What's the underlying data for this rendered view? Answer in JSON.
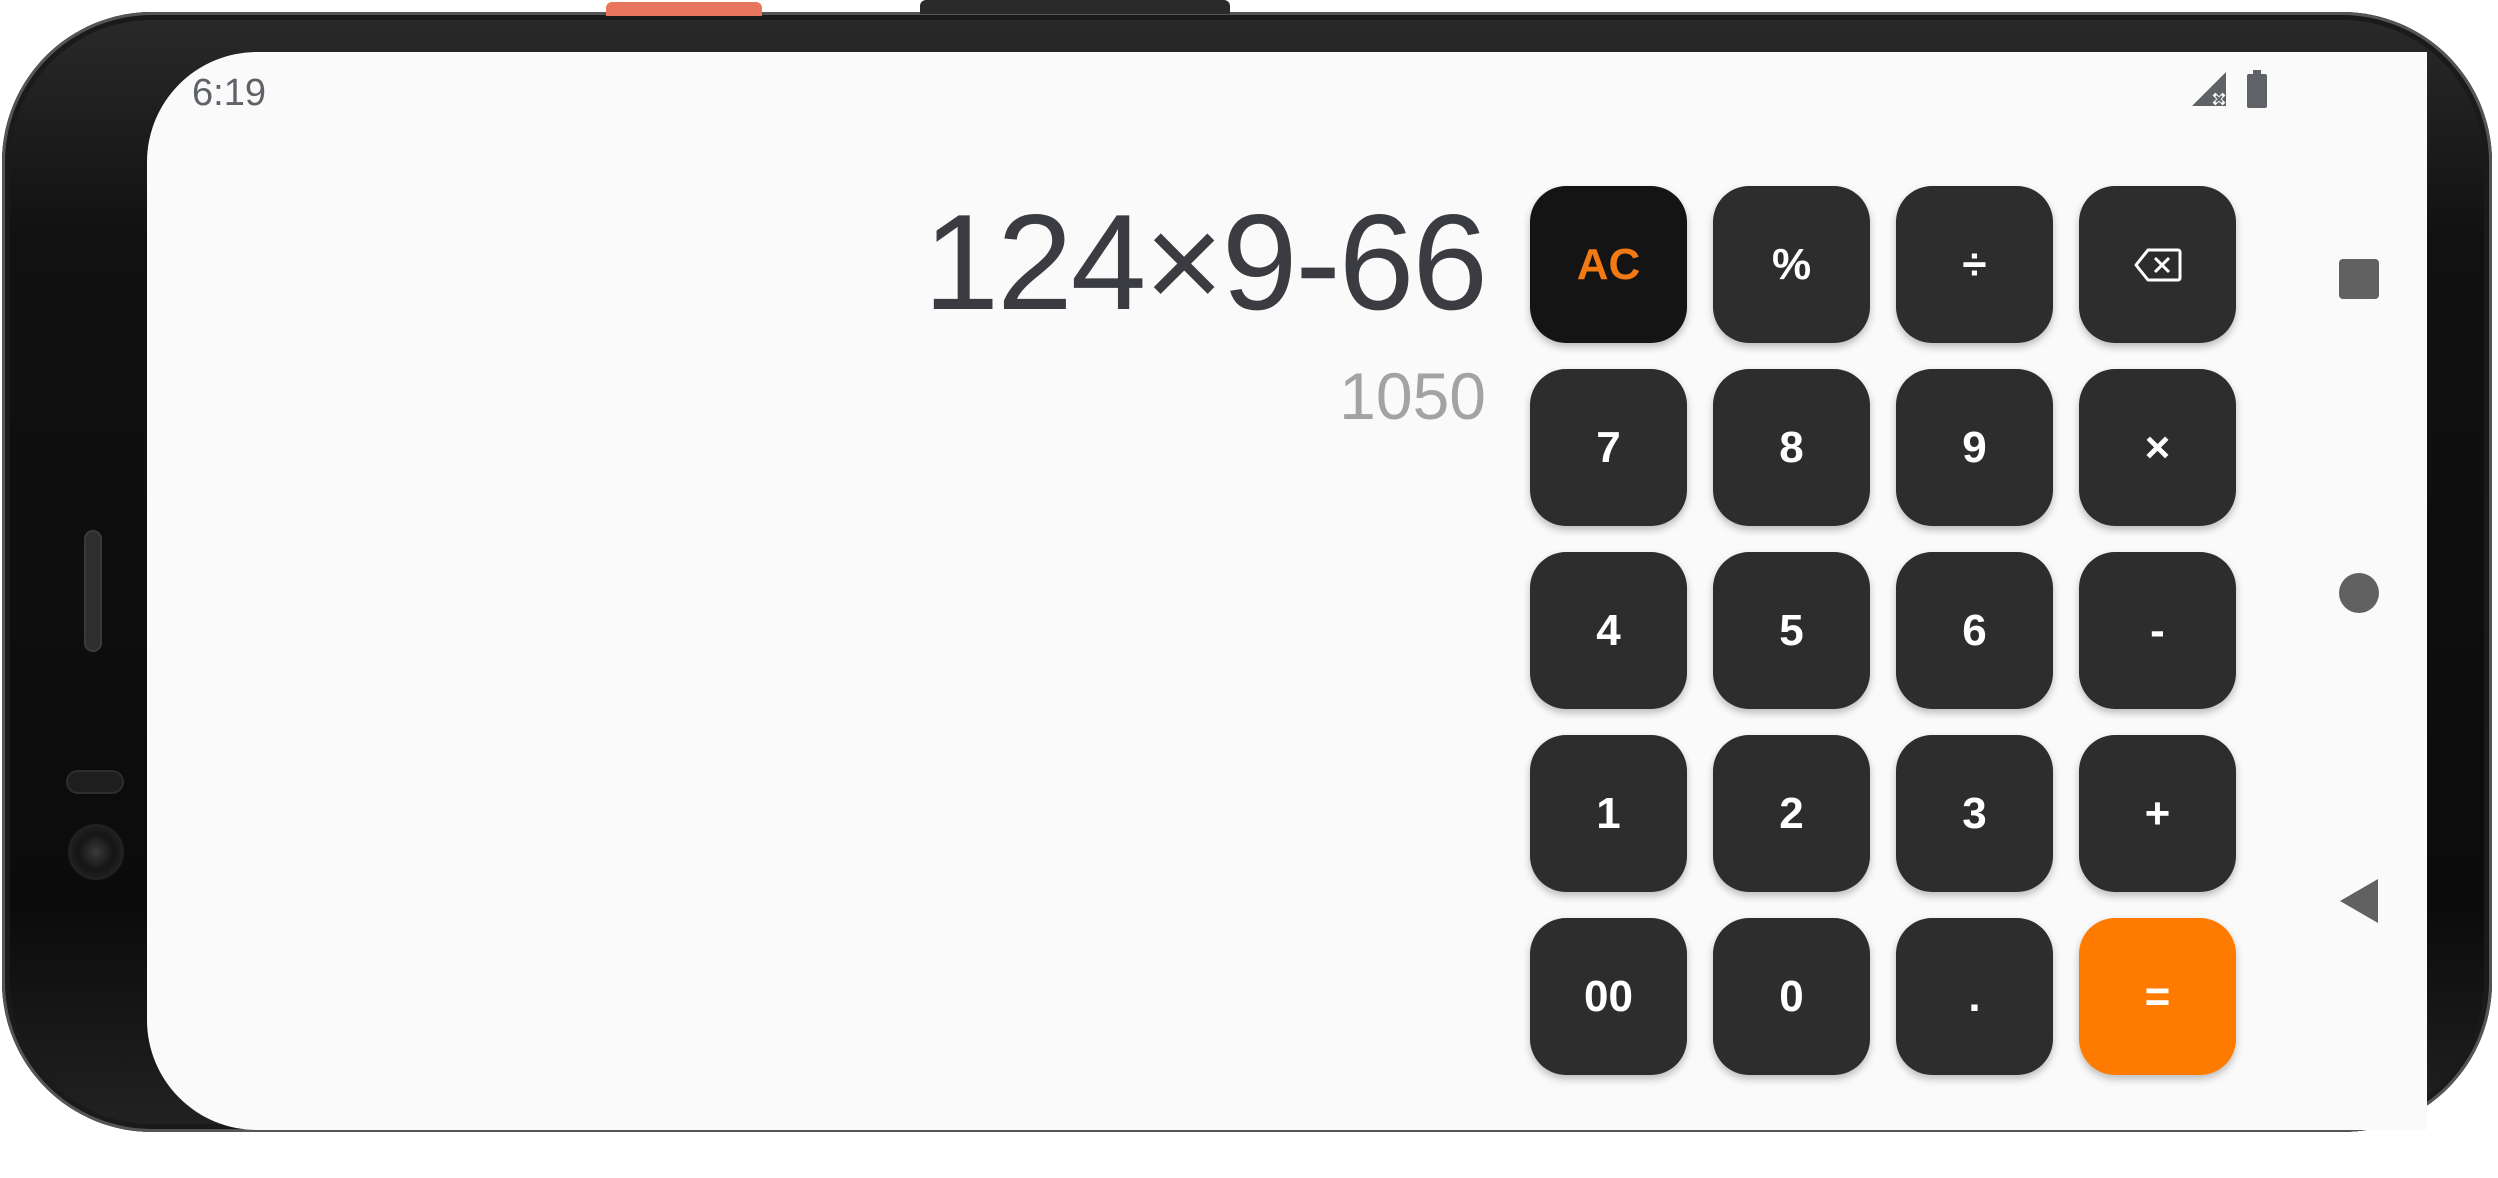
{
  "status_bar": {
    "time": "6:19",
    "icons": [
      "signal-off-icon",
      "battery-icon"
    ]
  },
  "display": {
    "expression": "124×9-66",
    "result": "1050"
  },
  "keypad": {
    "keys": [
      {
        "label": "AC",
        "name": "clear-button",
        "style": "ac"
      },
      {
        "label": "%",
        "name": "percent-button",
        "style": "normal"
      },
      {
        "label": "÷",
        "name": "divide-button",
        "style": "normal"
      },
      {
        "label": "",
        "name": "backspace-button",
        "style": "normal",
        "icon": "backspace-icon"
      },
      {
        "label": "7",
        "name": "digit-7-button",
        "style": "normal"
      },
      {
        "label": "8",
        "name": "digit-8-button",
        "style": "normal"
      },
      {
        "label": "9",
        "name": "digit-9-button",
        "style": "normal"
      },
      {
        "label": "×",
        "name": "multiply-button",
        "style": "normal"
      },
      {
        "label": "4",
        "name": "digit-4-button",
        "style": "normal"
      },
      {
        "label": "5",
        "name": "digit-5-button",
        "style": "normal"
      },
      {
        "label": "6",
        "name": "digit-6-button",
        "style": "normal"
      },
      {
        "label": "-",
        "name": "subtract-button",
        "style": "normal"
      },
      {
        "label": "1",
        "name": "digit-1-button",
        "style": "normal"
      },
      {
        "label": "2",
        "name": "digit-2-button",
        "style": "normal"
      },
      {
        "label": "3",
        "name": "digit-3-button",
        "style": "normal"
      },
      {
        "label": "+",
        "name": "add-button",
        "style": "normal"
      },
      {
        "label": "00",
        "name": "double-zero-button",
        "style": "normal"
      },
      {
        "label": "0",
        "name": "digit-0-button",
        "style": "normal"
      },
      {
        "label": ".",
        "name": "decimal-button",
        "style": "normal"
      },
      {
        "label": "=",
        "name": "equals-button",
        "style": "eq"
      }
    ]
  },
  "nav_bar": {
    "buttons": [
      "recents-icon",
      "home-icon",
      "back-icon"
    ]
  },
  "colors": {
    "accent": "#ff7b00",
    "ac_text": "#f37a12",
    "key_bg": "#2d2d2d",
    "ac_bg": "#141414",
    "screen_bg": "#fafafa"
  }
}
